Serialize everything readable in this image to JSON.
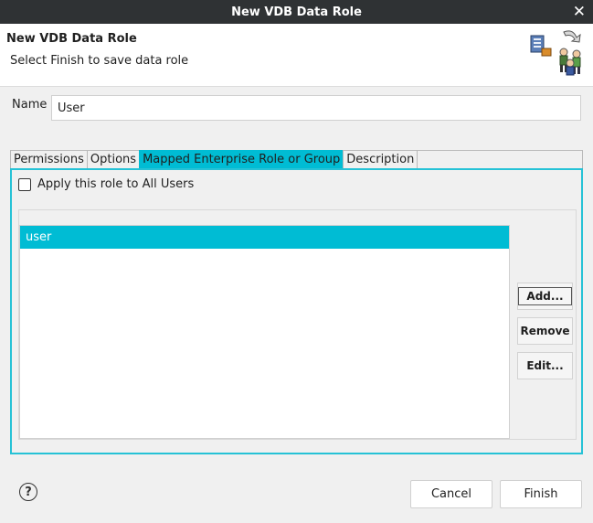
{
  "window": {
    "title": "New VDB Data Role",
    "close_glyph": "✕"
  },
  "header": {
    "title": "New VDB Data Role",
    "message": "Select Finish to save data role",
    "image_icon": "data-role-wizard-banner-icon"
  },
  "name_field": {
    "label": "Name",
    "value": "User"
  },
  "tabs": [
    {
      "label": "Permissions"
    },
    {
      "label": "Options"
    },
    {
      "label": "Mapped Enterprise Role or Group"
    },
    {
      "label": "Description"
    }
  ],
  "active_tab": "Mapped Enterprise Role or Group",
  "mapped_roles": {
    "apply_all_label": "Apply this role to All Users",
    "apply_all_checked": false,
    "items": [
      {
        "label": "user"
      }
    ],
    "buttons": {
      "add": "Add...",
      "remove": "Remove",
      "edit": "Edit..."
    }
  },
  "footer": {
    "help_glyph": "?",
    "cancel": "Cancel",
    "finish": "Finish"
  },
  "colors": {
    "accent": "#00bcd4",
    "titlebar": "#2f3234",
    "panel_border": "#26c2d6"
  }
}
